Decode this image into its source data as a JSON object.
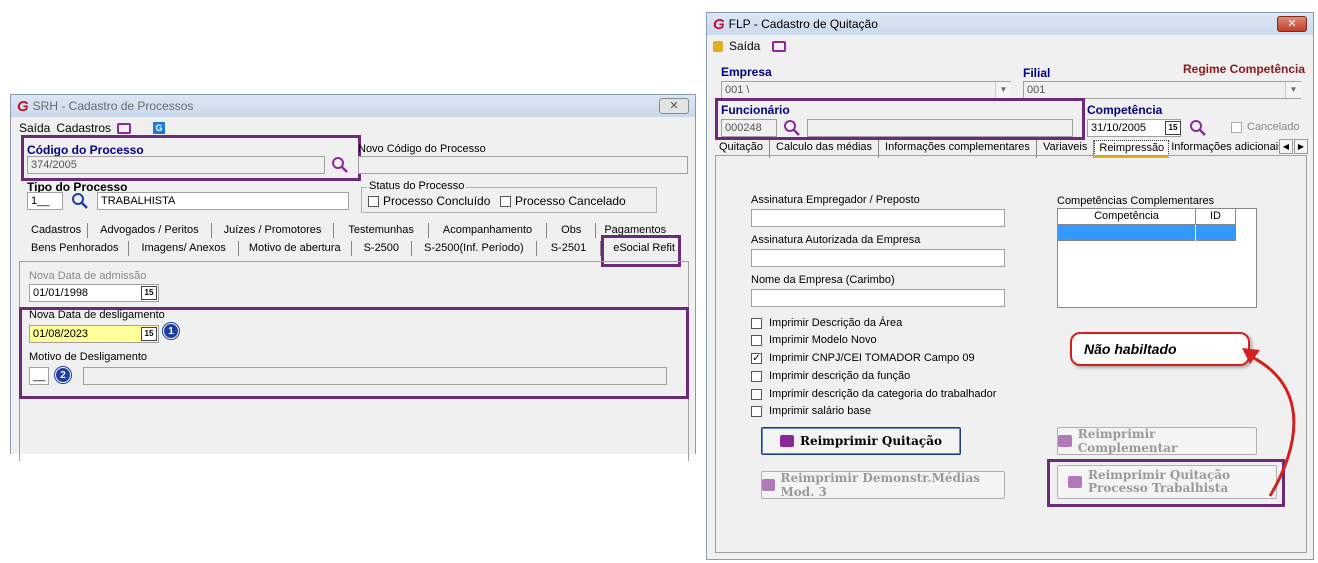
{
  "left": {
    "title": "SRH - Cadastro de Processos",
    "menu": {
      "saida": "Saída",
      "cadastros": "Cadastros"
    },
    "codigo_label": "Código do Processo",
    "codigo_value": "374/2005",
    "novo_codigo_label": "Novo Código do Processo",
    "tipo_label": "Tipo do Processo",
    "tipo_code": "1__",
    "tipo_value": "TRABALHISTA",
    "status_label": "Status do Processo",
    "status_concluido": "Processo Concluído",
    "status_cancelado": "Processo Cancelado",
    "tabs_row1": [
      "Cadastros",
      "Advogados / Peritos",
      "Juízes / Promotores",
      "Testemunhas",
      "Acompanhamento",
      "Obs",
      "Pagamentos"
    ],
    "tabs_row2": [
      "Bens Penhorados",
      "Imagens/ Anexos",
      "Motivo de abertura",
      "S-2500",
      "S-2500(Inf. Período)",
      "S-2501",
      "eSocial Refit"
    ],
    "nova_admissao_label": "Nova Data de admissão",
    "nova_admissao_value": "01/01/1998",
    "nova_deslig_label": "Nova Data de desligamento",
    "nova_deslig_value": "01/08/2023",
    "motivo_label": "Motivo de Desligamento",
    "motivo_code": "__",
    "badge1": "1",
    "badge2": "2",
    "cal_icon": "15"
  },
  "right": {
    "title": "FLP - Cadastro de Quitação",
    "menu": {
      "saida": "Saída"
    },
    "empresa_label": "Empresa",
    "empresa_value": "001 \\",
    "filial_label": "Filial",
    "filial_value": "001",
    "regime": "Regime Competência",
    "func_label": "Funcionário",
    "func_value": "000248",
    "comp_label": "Competência",
    "comp_value": "31/10/2005",
    "cancelado": "Cancelado",
    "tabs": [
      "Quitação",
      "Calculo das médias",
      "Informações complementares",
      "Variaveis",
      "Reimpressão",
      "Informações adicionais"
    ],
    "assin_emp_label": "Assinatura Empregador / Preposto",
    "assin_aut_label": "Assinatura Autorizada da Empresa",
    "nome_emp_label": "Nome da Empresa (Carimbo)",
    "comp_compl_label": "Competências Complementares",
    "grid_headers": [
      "Competência",
      "ID"
    ],
    "checks": [
      "Imprimir Descrição da Área",
      "Imprimir Modelo Novo",
      "Imprimir CNPJ/CEI TOMADOR Campo 09",
      "Imprimir descrição da função",
      "Imprimir descrição da categoria do trabalhador",
      "Imprimir salário base"
    ],
    "btn_reimprimir": "Reimprimir Quitação",
    "btn_complementar": "Reimprimir Complementar",
    "btn_demonstr": "Reimprimir Demonstr.Médias Mod. 3",
    "btn_processo": "Reimprimir Quitação Processo Trabalhista",
    "callout": "Não habiltado",
    "cal_icon": "15"
  }
}
